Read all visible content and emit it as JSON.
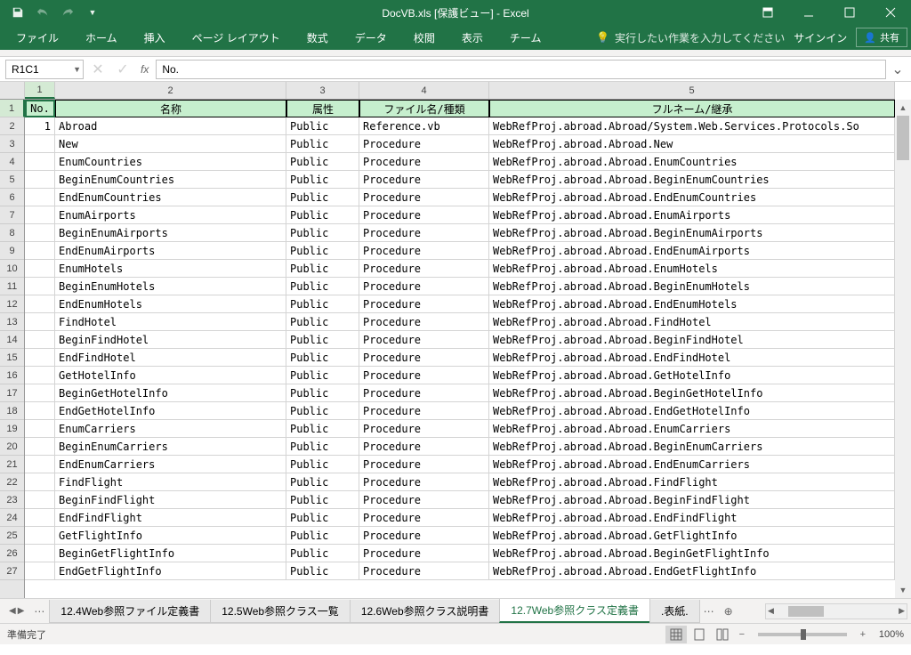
{
  "title": "DocVB.xls [保護ビュー] - Excel",
  "qa": {
    "undo_disabled": true,
    "redo_disabled": true
  },
  "ribbon": {
    "file": "ファイル",
    "tabs": [
      "ホーム",
      "挿入",
      "ページ レイアウト",
      "数式",
      "データ",
      "校閲",
      "表示",
      "チーム"
    ],
    "tellme": "実行したい作業を入力してください",
    "signin": "サインイン",
    "share": "共有"
  },
  "formula_bar": {
    "name_box": "R1C1",
    "fx": "fx",
    "value": "No."
  },
  "grid": {
    "col_labels": [
      "1",
      "2",
      "3",
      "4",
      "5"
    ],
    "row_count": 27,
    "header": [
      "No.",
      "名称",
      "属性",
      "ファイル名/種類",
      "フルネーム/継承"
    ],
    "rows": [
      [
        "1",
        "Abroad",
        "Public",
        "Reference.vb",
        "WebRefProj.abroad.Abroad/System.Web.Services.Protocols.So"
      ],
      [
        "",
        "New",
        "Public",
        "Procedure",
        "WebRefProj.abroad.Abroad.New"
      ],
      [
        "",
        "EnumCountries",
        "Public",
        "Procedure",
        "WebRefProj.abroad.Abroad.EnumCountries"
      ],
      [
        "",
        "BeginEnumCountries",
        "Public",
        "Procedure",
        "WebRefProj.abroad.Abroad.BeginEnumCountries"
      ],
      [
        "",
        "EndEnumCountries",
        "Public",
        "Procedure",
        "WebRefProj.abroad.Abroad.EndEnumCountries"
      ],
      [
        "",
        "EnumAirports",
        "Public",
        "Procedure",
        "WebRefProj.abroad.Abroad.EnumAirports"
      ],
      [
        "",
        "BeginEnumAirports",
        "Public",
        "Procedure",
        "WebRefProj.abroad.Abroad.BeginEnumAirports"
      ],
      [
        "",
        "EndEnumAirports",
        "Public",
        "Procedure",
        "WebRefProj.abroad.Abroad.EndEnumAirports"
      ],
      [
        "",
        "EnumHotels",
        "Public",
        "Procedure",
        "WebRefProj.abroad.Abroad.EnumHotels"
      ],
      [
        "",
        "BeginEnumHotels",
        "Public",
        "Procedure",
        "WebRefProj.abroad.Abroad.BeginEnumHotels"
      ],
      [
        "",
        "EndEnumHotels",
        "Public",
        "Procedure",
        "WebRefProj.abroad.Abroad.EndEnumHotels"
      ],
      [
        "",
        "FindHotel",
        "Public",
        "Procedure",
        "WebRefProj.abroad.Abroad.FindHotel"
      ],
      [
        "",
        "BeginFindHotel",
        "Public",
        "Procedure",
        "WebRefProj.abroad.Abroad.BeginFindHotel"
      ],
      [
        "",
        "EndFindHotel",
        "Public",
        "Procedure",
        "WebRefProj.abroad.Abroad.EndFindHotel"
      ],
      [
        "",
        "GetHotelInfo",
        "Public",
        "Procedure",
        "WebRefProj.abroad.Abroad.GetHotelInfo"
      ],
      [
        "",
        "BeginGetHotelInfo",
        "Public",
        "Procedure",
        "WebRefProj.abroad.Abroad.BeginGetHotelInfo"
      ],
      [
        "",
        "EndGetHotelInfo",
        "Public",
        "Procedure",
        "WebRefProj.abroad.Abroad.EndGetHotelInfo"
      ],
      [
        "",
        "EnumCarriers",
        "Public",
        "Procedure",
        "WebRefProj.abroad.Abroad.EnumCarriers"
      ],
      [
        "",
        "BeginEnumCarriers",
        "Public",
        "Procedure",
        "WebRefProj.abroad.Abroad.BeginEnumCarriers"
      ],
      [
        "",
        "EndEnumCarriers",
        "Public",
        "Procedure",
        "WebRefProj.abroad.Abroad.EndEnumCarriers"
      ],
      [
        "",
        "FindFlight",
        "Public",
        "Procedure",
        "WebRefProj.abroad.Abroad.FindFlight"
      ],
      [
        "",
        "BeginFindFlight",
        "Public",
        "Procedure",
        "WebRefProj.abroad.Abroad.BeginFindFlight"
      ],
      [
        "",
        "EndFindFlight",
        "Public",
        "Procedure",
        "WebRefProj.abroad.Abroad.EndFindFlight"
      ],
      [
        "",
        "GetFlightInfo",
        "Public",
        "Procedure",
        "WebRefProj.abroad.Abroad.GetFlightInfo"
      ],
      [
        "",
        "BeginGetFlightInfo",
        "Public",
        "Procedure",
        "WebRefProj.abroad.Abroad.BeginGetFlightInfo"
      ],
      [
        "",
        "EndGetFlightInfo",
        "Public",
        "Procedure",
        "WebRefProj.abroad.Abroad.EndGetFlightInfo"
      ]
    ]
  },
  "sheets": {
    "tabs": [
      "12.4Web参照ファイル定義書",
      "12.5Web参照クラス一覧",
      "12.6Web参照クラス説明書",
      "12.7Web参照クラス定義書",
      ".表紙."
    ],
    "active_index": 3
  },
  "status": {
    "left": "準備完了",
    "zoom": "100%"
  }
}
